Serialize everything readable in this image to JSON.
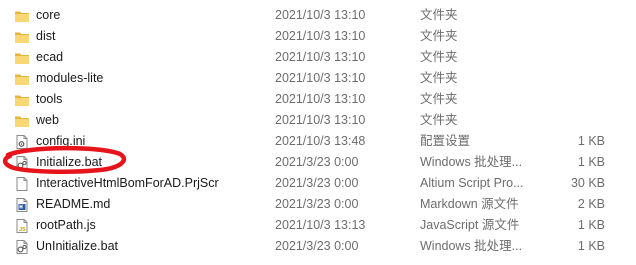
{
  "files": [
    {
      "name": "core",
      "date": "2021/10/3 13:10",
      "type": "文件夹",
      "size": "",
      "icon": "folder-icon"
    },
    {
      "name": "dist",
      "date": "2021/10/3 13:10",
      "type": "文件夹",
      "size": "",
      "icon": "folder-icon"
    },
    {
      "name": "ecad",
      "date": "2021/10/3 13:10",
      "type": "文件夹",
      "size": "",
      "icon": "folder-icon"
    },
    {
      "name": "modules-lite",
      "date": "2021/10/3 13:10",
      "type": "文件夹",
      "size": "",
      "icon": "folder-icon"
    },
    {
      "name": "tools",
      "date": "2021/10/3 13:10",
      "type": "文件夹",
      "size": "",
      "icon": "folder-icon"
    },
    {
      "name": "web",
      "date": "2021/10/3 13:10",
      "type": "文件夹",
      "size": "",
      "icon": "folder-icon"
    },
    {
      "name": "config.ini",
      "date": "2021/10/3 13:48",
      "type": "配置设置",
      "size": "1 KB",
      "icon": "config-file-icon"
    },
    {
      "name": "Initialize.bat",
      "date": "2021/3/23 0:00",
      "type": "Windows 批处理...",
      "size": "1 KB",
      "icon": "batch-file-icon"
    },
    {
      "name": "InteractiveHtmlBomForAD.PrjScr",
      "date": "2021/3/23 0:00",
      "type": "Altium Script Pro...",
      "size": "30 KB",
      "icon": "blank-file-icon"
    },
    {
      "name": "README.md",
      "date": "2021/3/23 0:00",
      "type": "Markdown 源文件",
      "size": "2 KB",
      "icon": "markdown-file-icon"
    },
    {
      "name": "rootPath.js",
      "date": "2021/10/3 13:13",
      "type": "JavaScript 源文件",
      "size": "1 KB",
      "icon": "javascript-file-icon"
    },
    {
      "name": "UnInitialize.bat",
      "date": "2021/3/23 0:00",
      "type": "Windows 批处理...",
      "size": "1 KB",
      "icon": "batch-file-icon"
    }
  ],
  "highlight": {
    "target": "Initialize.bat",
    "color": "#e8141b"
  },
  "colors": {
    "folder": "#f8d775",
    "folder_dark": "#e8b53c",
    "text": "#1a1a1a",
    "secondary_text": "#6d6d6d"
  }
}
